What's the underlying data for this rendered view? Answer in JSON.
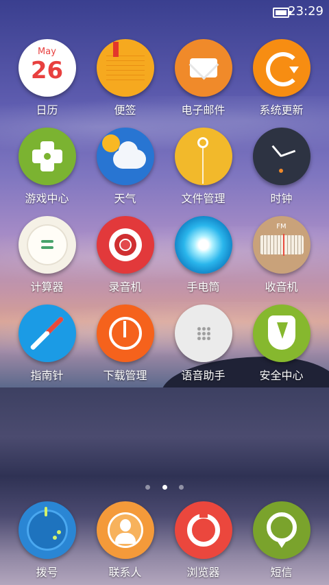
{
  "status_bar": {
    "time": "23:29",
    "battery_icon": "battery-icon"
  },
  "apps": [
    {
      "label": "日历",
      "icon": "calendar-icon",
      "cal_month": "May",
      "cal_day": "26"
    },
    {
      "label": "便签",
      "icon": "notes-icon"
    },
    {
      "label": "电子邮件",
      "icon": "email-icon"
    },
    {
      "label": "系统更新",
      "icon": "system-update-icon"
    },
    {
      "label": "游戏中心",
      "icon": "game-center-icon"
    },
    {
      "label": "天气",
      "icon": "weather-icon"
    },
    {
      "label": "文件管理",
      "icon": "file-manager-icon"
    },
    {
      "label": "时钟",
      "icon": "clock-icon"
    },
    {
      "label": "计算器",
      "icon": "calculator-icon"
    },
    {
      "label": "录音机",
      "icon": "recorder-icon"
    },
    {
      "label": "手电筒",
      "icon": "flashlight-icon"
    },
    {
      "label": "收音机",
      "icon": "radio-icon",
      "radio_text": "FM"
    },
    {
      "label": "指南针",
      "icon": "compass-icon"
    },
    {
      "label": "下载管理",
      "icon": "download-manager-icon"
    },
    {
      "label": "语音助手",
      "icon": "voice-assistant-icon"
    },
    {
      "label": "安全中心",
      "icon": "security-center-icon"
    }
  ],
  "page_indicator": {
    "pages": 3,
    "current": 2
  },
  "dock": [
    {
      "label": "拨号",
      "icon": "dialer-icon"
    },
    {
      "label": "联系人",
      "icon": "contacts-icon"
    },
    {
      "label": "浏览器",
      "icon": "browser-icon"
    },
    {
      "label": "短信",
      "icon": "messages-icon"
    }
  ]
}
